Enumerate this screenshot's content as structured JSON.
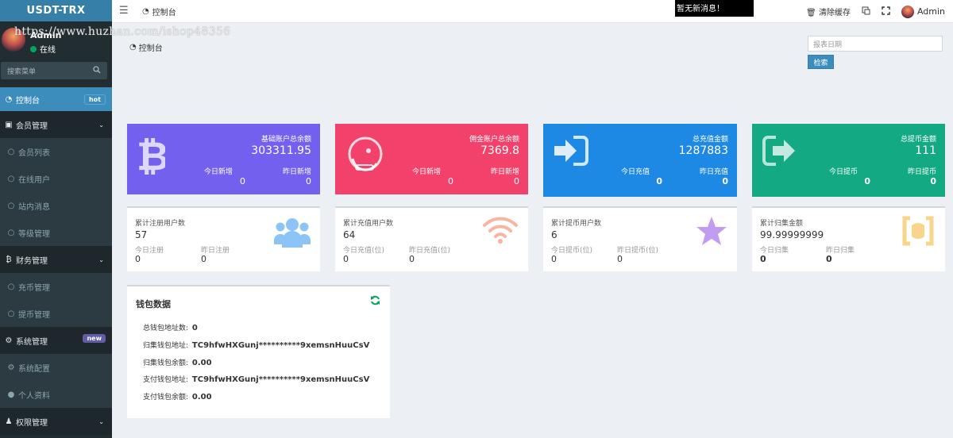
{
  "app": {
    "logo": "USDT-TRX",
    "watermark": "https://www.huzhan.com/ishop48356"
  },
  "user": {
    "name": "Admin",
    "status": "在线"
  },
  "sidebar": {
    "search_placeholder": "搜索菜单",
    "items": [
      {
        "label": "控制台",
        "badge": "hot"
      },
      {
        "label": "会员管理"
      },
      {
        "label": "会员列表"
      },
      {
        "label": "在线用户"
      },
      {
        "label": "站内消息"
      },
      {
        "label": "等级管理"
      },
      {
        "label": "财务管理"
      },
      {
        "label": "充币管理"
      },
      {
        "label": "提币管理"
      },
      {
        "label": "系统管理",
        "badge": "new"
      },
      {
        "label": "系统配置"
      },
      {
        "label": "个人资料"
      },
      {
        "label": "权限管理"
      }
    ]
  },
  "topbar": {
    "tab_label": "控制台",
    "notice": "暂无新消息！",
    "clear_cache": "清除缓存",
    "user_name": "Admin"
  },
  "main": {
    "breadcrumb": "控制台",
    "date_placeholder": "报表日期",
    "search_button": "检索"
  },
  "stat_cards": [
    {
      "label": "基础账户总余额",
      "value": "303311.95",
      "sub1_label": "今日新增",
      "sub1_value": "0",
      "sub2_label": "昨日新增",
      "sub2_value": "0",
      "color": "#7460ee"
    },
    {
      "label": "佣金账户总余额",
      "value": "7369.8",
      "sub1_label": "今日新增",
      "sub1_value": "0",
      "sub2_label": "昨日新增",
      "sub2_value": "0",
      "color": "#f2416a"
    },
    {
      "label": "总充值金额",
      "value": "1287883",
      "sub1_label": "今日充值",
      "sub1_value": "0",
      "sub2_label": "昨日充值",
      "sub2_value": "0",
      "color": "#1e88e5"
    },
    {
      "label": "总提币金额",
      "value": "111",
      "sub1_label": "今日提币",
      "sub1_value": "0",
      "sub2_label": "昨日提币",
      "sub2_value": "0",
      "color": "#13a983"
    }
  ],
  "info_cards": [
    {
      "label": "累计注册用户数",
      "value": "57",
      "s1_label": "今日注册",
      "s1_value": "0",
      "s2_label": "昨日注册",
      "s2_value": "0",
      "icon": "users-icon",
      "icon_color": "#8cc5f5"
    },
    {
      "label": "累计充值用户数",
      "value": "64",
      "s1_label": "今日充值(位)",
      "s1_value": "0",
      "s2_label": "昨日充值(位)",
      "s2_value": "0",
      "icon": "wifi-icon",
      "icon_color": "#f9b5a0"
    },
    {
      "label": "累计提币用户数",
      "value": "6",
      "s1_label": "今日提币(位)",
      "s1_value": "0",
      "s2_label": "昨日提币(位)",
      "s2_value": "0",
      "icon": "star-icon",
      "icon_color": "#c29cf0"
    },
    {
      "label": "累计归集金额",
      "value": "99.99999999",
      "s1_label": "今日归集",
      "s1_value": "0",
      "s2_label": "昨日归集",
      "s2_value": "0",
      "icon": "bracket-icon",
      "icon_color": "#f8d58a"
    }
  ],
  "wallet": {
    "title": "钱包数据",
    "rows": [
      {
        "label": "总钱包地址数:",
        "value": "0"
      },
      {
        "label": "归集钱包地址:",
        "value": "TC9hfwHXGunj**********9xemsnHuuCsV"
      },
      {
        "label": "归集钱包余额:",
        "value": "0.00"
      },
      {
        "label": "支付钱包地址:",
        "value": "TC9hfwHXGunj**********9xemsnHuuCsV"
      },
      {
        "label": "支付钱包余额:",
        "value": "0.00"
      }
    ]
  }
}
